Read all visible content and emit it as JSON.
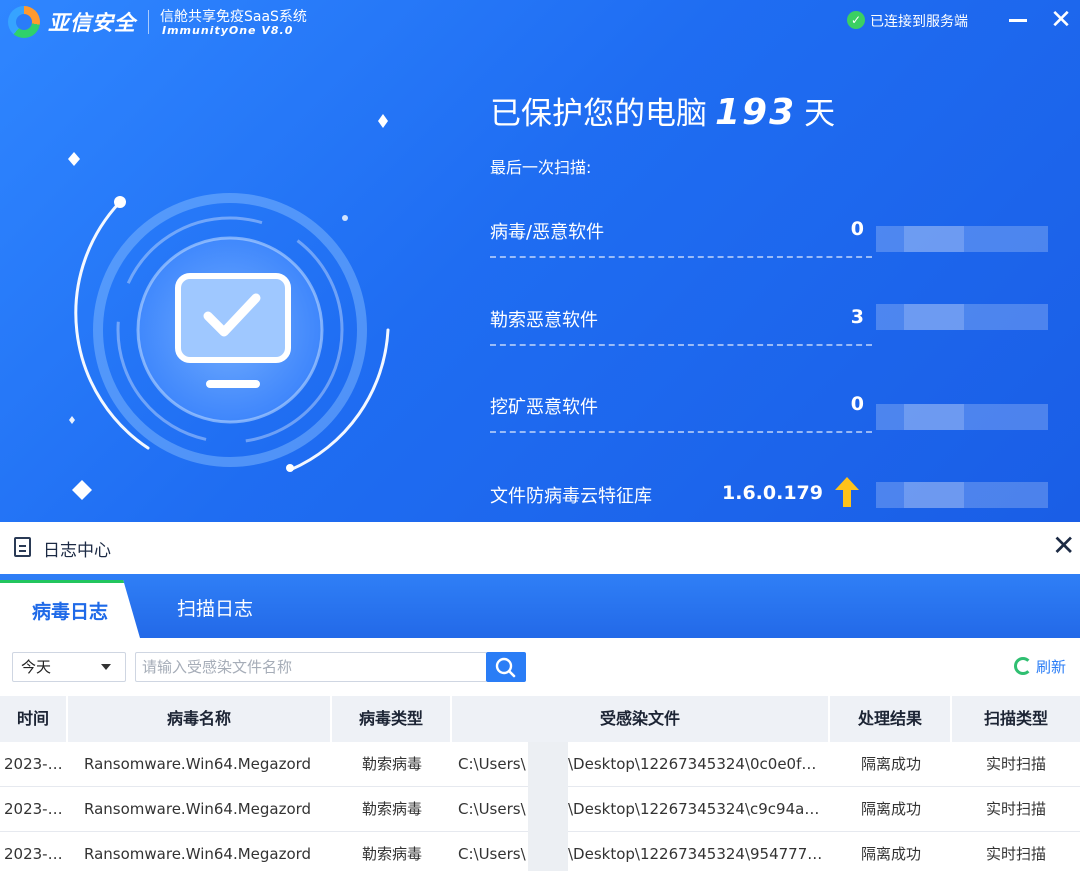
{
  "titlebar": {
    "brand": "亚信安全",
    "product": "信舱共享免疫SaaS系统",
    "version": "ImmunityOne V8.0",
    "connection_status": "已连接到服务端"
  },
  "protection": {
    "prefix": "已保护您的电脑",
    "days": "193",
    "suffix": "天",
    "last_scan_label": "最后一次扫描:",
    "stats": [
      {
        "label": "病毒/恶意软件",
        "value": "0"
      },
      {
        "label": "勒索恶意软件",
        "value": "3"
      },
      {
        "label": "挖矿恶意软件",
        "value": "0"
      }
    ],
    "db_label": "文件防病毒云特征库",
    "db_version": "1.6.0.179"
  },
  "log_center": {
    "title": "日志中心",
    "tabs": [
      {
        "label": "病毒日志",
        "active": true
      },
      {
        "label": "扫描日志",
        "active": false
      }
    ],
    "filter": {
      "date_value": "今天",
      "search_placeholder": "请输入受感染文件名称",
      "refresh_label": "刷新"
    },
    "table": {
      "columns": [
        "时间",
        "病毒名称",
        "病毒类型",
        "受感染文件",
        "处理结果",
        "扫描类型"
      ],
      "rows": [
        {
          "time": "2023-…",
          "name": "Ransomware.Win64.Megazord",
          "type": "勒索病毒",
          "file_prefix": "C:\\Users\\",
          "file_suffix": "\\Desktop\\12267345324\\0c0e0f…",
          "result": "隔离成功",
          "scan": "实时扫描"
        },
        {
          "time": "2023-…",
          "name": "Ransomware.Win64.Megazord",
          "type": "勒索病毒",
          "file_prefix": "C:\\Users\\",
          "file_suffix": "\\Desktop\\12267345324\\c9c94a…",
          "result": "隔离成功",
          "scan": "实时扫描"
        },
        {
          "time": "2023-…",
          "name": "Ransomware.Win64.Megazord",
          "type": "勒索病毒",
          "file_prefix": "C:\\Users\\",
          "file_suffix": "\\Desktop\\12267345324\\954777…",
          "result": "隔离成功",
          "scan": "实时扫描"
        }
      ]
    }
  },
  "colors": {
    "primary_blue": "#1f6df2",
    "active_tab_accent": "#22c55e",
    "connected_green": "#3bd062",
    "upgrade_arrow": "#ffc21a"
  },
  "icons": [
    "logo-icon",
    "check-circle-icon",
    "minimize-icon",
    "close-icon",
    "monitor-check-icon",
    "up-arrow-icon",
    "document-icon",
    "caret-down-icon",
    "search-icon",
    "refresh-icon"
  ]
}
